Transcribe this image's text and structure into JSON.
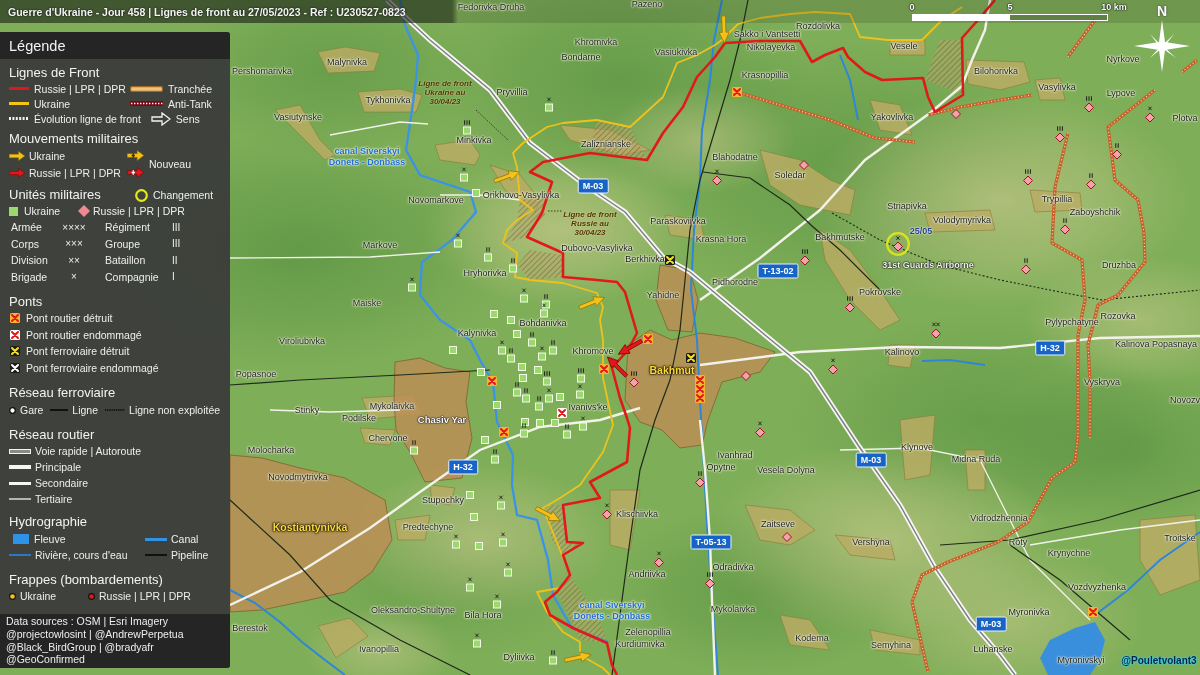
{
  "title": "Guerre d'Ukraine - Jour 458 | Lignes de front au 27/05/2023 - Ref : U230527-0823",
  "scale": {
    "labels": [
      "0",
      "5",
      "10 km"
    ]
  },
  "compass": {
    "label": "N"
  },
  "legend": {
    "title": "Légende",
    "front_lines": {
      "title": "Lignes de Front",
      "items": [
        {
          "kind": "russian_line",
          "label": "Russie | LPR | DPR"
        },
        {
          "kind": "trench",
          "label": "Tranchée"
        },
        {
          "kind": "ukrainian_line",
          "label": "Ukraine"
        },
        {
          "kind": "anti_tank",
          "label": "Anti-Tank"
        },
        {
          "kind": "evolution",
          "label": "Évolution ligne de front"
        },
        {
          "kind": "direction",
          "label": "Sens"
        }
      ]
    },
    "movements": {
      "title": "Mouvements militaires",
      "items": [
        {
          "kind": "ukraine",
          "label": "Ukraine"
        },
        {
          "kind": "russia",
          "label": "Russie | LPR | DPR"
        }
      ],
      "new_items": [
        {
          "kind": "ukraine"
        },
        {
          "kind": "russia"
        }
      ],
      "new_label": "Nouveau"
    },
    "units": {
      "title": "Unités militaires",
      "change_label": "Changement",
      "sides": [
        {
          "kind": "ukraine",
          "label": "Ukraine"
        },
        {
          "kind": "russia",
          "label": "Russie | LPR | DPR"
        }
      ],
      "echelons": [
        {
          "label": "Armée",
          "mark": "××××"
        },
        {
          "label": "Régiment",
          "mark": "III"
        },
        {
          "label": "Corps",
          "mark": "×××"
        },
        {
          "label": "Groupe",
          "mark": "III"
        },
        {
          "label": "Division",
          "mark": "××"
        },
        {
          "label": "Bataillon",
          "mark": "II"
        },
        {
          "label": "Brigade",
          "mark": "×"
        },
        {
          "label": "Compagnie",
          "mark": "I"
        }
      ]
    },
    "bridges": {
      "title": "Ponts",
      "items": [
        {
          "kind": "road_destroyed",
          "label": "Pont routier détruit"
        },
        {
          "kind": "road_damaged",
          "label": "Pont routier endommagé"
        },
        {
          "kind": "rail_destroyed",
          "label": "Pont ferroviaire détruit"
        },
        {
          "kind": "rail_damaged",
          "label": "Pont ferroviaire endommagé"
        }
      ]
    },
    "railway": {
      "title": "Réseau ferroviaire",
      "items": [
        {
          "kind": "station",
          "label": "Gare"
        },
        {
          "kind": "line",
          "label": "Ligne"
        },
        {
          "kind": "disused",
          "label": "Ligne non exploitée"
        }
      ]
    },
    "roads": {
      "title": "Réseau routier",
      "items": [
        {
          "kind": "highway",
          "label": "Voie rapide | Autoroute"
        },
        {
          "kind": "primary",
          "label": "Principale"
        },
        {
          "kind": "secondary",
          "label": "Secondaire"
        },
        {
          "kind": "tertiary",
          "label": "Tertiaire"
        }
      ]
    },
    "hydrography": {
      "title": "Hydrographie",
      "items": [
        {
          "kind": "fleuve",
          "label": "Fleuve"
        },
        {
          "kind": "canal",
          "label": "Canal"
        },
        {
          "kind": "river",
          "label": "Rivière, cours d'eau"
        },
        {
          "kind": "pipeline",
          "label": "Pipeline"
        }
      ]
    },
    "strikes": {
      "title": "Frappes (bombardements)",
      "items": [
        {
          "kind": "ukraine",
          "label": "Ukraine"
        },
        {
          "kind": "russia",
          "label": "Russie | LPR | DPR"
        }
      ]
    },
    "sources": [
      "Data sources : OSM | Esri Imagery",
      "@projectowlosint | @AndrewPerpetua",
      "@Black_BirdGroup | @bradyafr",
      "@GeoConfirmed"
    ]
  },
  "map": {
    "places": [
      {
        "kind": "village",
        "name": "Fedorivka Druha"
      },
      {
        "kind": "village",
        "name": "Pazeno"
      },
      {
        "kind": "village",
        "name": "Rozdolivka"
      },
      {
        "kind": "village",
        "name": "Sakko i Vantsetti"
      },
      {
        "kind": "village",
        "name": "Khromivka"
      },
      {
        "kind": "village",
        "name": "Nikolayevka"
      },
      {
        "kind": "village",
        "name": "Vesele"
      },
      {
        "kind": "village",
        "name": "Malynivka"
      },
      {
        "kind": "village",
        "name": "Bondarne"
      },
      {
        "kind": "village",
        "name": "Vasiukivka"
      },
      {
        "kind": "village",
        "name": "Nyrkove"
      },
      {
        "kind": "village",
        "name": "Pershomarivka"
      },
      {
        "kind": "village",
        "name": "Krasnopillia"
      },
      {
        "kind": "village",
        "name": "Bilohorivka"
      },
      {
        "kind": "village",
        "name": "Tykhonivka"
      },
      {
        "kind": "note",
        "lines": [
          "Ligne de front",
          "Ukraine au",
          "30/04/23"
        ]
      },
      {
        "kind": "village",
        "name": "Pryvillia"
      },
      {
        "kind": "village",
        "name": "Vasylivka"
      },
      {
        "kind": "village",
        "name": "Lypove"
      },
      {
        "kind": "village",
        "name": "Vasiutynske"
      },
      {
        "kind": "village",
        "name": "Yakovlivka"
      },
      {
        "kind": "village",
        "name": "Plotva"
      },
      {
        "kind": "village",
        "name": "Minkivka"
      },
      {
        "kind": "village",
        "name": "Zaliznianske"
      },
      {
        "kind": "canal",
        "lines": [
          "canal Siverskyi",
          "Donets - Donbass"
        ]
      },
      {
        "kind": "village",
        "name": "Blahodatne"
      },
      {
        "kind": "village",
        "name": "Soledar"
      },
      {
        "kind": "village",
        "name": "Novomarkove"
      },
      {
        "kind": "village",
        "name": "Orikhovo-Vasylivka"
      },
      {
        "kind": "village",
        "name": "Striapivka"
      },
      {
        "kind": "village",
        "name": "Trypillia"
      },
      {
        "kind": "note",
        "lines": [
          "Ligne de front",
          "Russie au",
          "30/04/23"
        ]
      },
      {
        "kind": "village",
        "name": "Zaboyshchik"
      },
      {
        "kind": "village",
        "name": "Paraskoviivka"
      },
      {
        "kind": "village",
        "name": "Volodymyrivka"
      },
      {
        "kind": "village",
        "name": "Krasna Hora"
      },
      {
        "kind": "village",
        "name": "Bakhmutske"
      },
      {
        "kind": "village",
        "name": "Markove"
      },
      {
        "kind": "village",
        "name": "Dubovo-Vasylivka"
      },
      {
        "kind": "village",
        "name": "Berkhivka"
      },
      {
        "kind": "village",
        "name": "Druzhba"
      },
      {
        "kind": "village",
        "name": "Hryhorivka"
      },
      {
        "kind": "village",
        "name": "Pidhorodne"
      },
      {
        "kind": "village",
        "name": "Yahidne"
      },
      {
        "kind": "village",
        "name": "Pokrovske"
      },
      {
        "kind": "village",
        "name": "Maiske"
      },
      {
        "kind": "village",
        "name": "Pylypchatyne"
      },
      {
        "kind": "village",
        "name": "Rozovka"
      },
      {
        "kind": "village",
        "name": "Bohdanivka"
      },
      {
        "kind": "village",
        "name": "Kalynivka"
      },
      {
        "kind": "village",
        "name": "Viroliubivka"
      },
      {
        "kind": "village",
        "name": "Kalinova Popasnaya"
      },
      {
        "kind": "village",
        "name": "Khromove"
      },
      {
        "kind": "village",
        "name": "Kalinovo"
      },
      {
        "kind": "village",
        "name": "Popasnoe"
      },
      {
        "kind": "city",
        "name": "Bakhmut"
      },
      {
        "kind": "village",
        "name": "Vyskryva"
      },
      {
        "kind": "village",
        "name": "Stinky"
      },
      {
        "kind": "village",
        "name": "Mykolaivka"
      },
      {
        "kind": "village",
        "name": "Ivanivs'ke"
      },
      {
        "kind": "village",
        "name": "Novozv"
      },
      {
        "kind": "village",
        "name": "Podilske"
      },
      {
        "kind": "town",
        "name": "Chasiv Yar"
      },
      {
        "kind": "village",
        "name": "Chervone"
      },
      {
        "kind": "village",
        "name": "Molocharka"
      },
      {
        "kind": "village",
        "name": "Klynove"
      },
      {
        "kind": "village",
        "name": "Ivanhrad"
      },
      {
        "kind": "village",
        "name": "Midna Ruda"
      },
      {
        "kind": "village",
        "name": "Opytne"
      },
      {
        "kind": "village",
        "name": "Vesela Dolyna"
      },
      {
        "kind": "village",
        "name": "Novodmytrivka"
      },
      {
        "kind": "village",
        "name": "Stupochky"
      },
      {
        "kind": "city",
        "name": "Kostiantynivka"
      },
      {
        "kind": "village",
        "name": "Predtechyne"
      },
      {
        "kind": "village",
        "name": "Klischiivka"
      },
      {
        "kind": "village",
        "name": "Zaitseve"
      },
      {
        "kind": "village",
        "name": "Vidrodzhennia"
      },
      {
        "kind": "village",
        "name": "Vershyna"
      },
      {
        "kind": "village",
        "name": "Roty"
      },
      {
        "kind": "village",
        "name": "Troitske"
      },
      {
        "kind": "village",
        "name": "Krynychne"
      },
      {
        "kind": "village",
        "name": "Odradivka"
      },
      {
        "kind": "village",
        "name": "Andriivka"
      },
      {
        "kind": "village",
        "name": "Vozdvyzhenka"
      },
      {
        "kind": "village",
        "name": "Oleksandro-Shultyne"
      },
      {
        "kind": "village",
        "name": "Bila Hora"
      },
      {
        "kind": "canal",
        "lines": [
          "canal Siverskyi",
          "Donets - Donbass"
        ]
      },
      {
        "kind": "village",
        "name": "Mykolaivka"
      },
      {
        "kind": "village",
        "name": "Myronivka"
      },
      {
        "kind": "village",
        "name": "Berestok"
      },
      {
        "kind": "village",
        "name": "Zelenopillia"
      },
      {
        "kind": "village",
        "name": "Ivanopillia"
      },
      {
        "kind": "village",
        "name": "Kurdiumivka"
      },
      {
        "kind": "village",
        "name": "Kodema"
      },
      {
        "kind": "village",
        "name": "Semyhina"
      },
      {
        "kind": "village",
        "name": "Luhanske"
      },
      {
        "kind": "village",
        "name": "Dyliivka"
      },
      {
        "kind": "village",
        "name": "Myronivskyi"
      }
    ],
    "road_shields": [
      "M-03",
      "T-13-02",
      "H-32",
      "M-03",
      "H-32",
      "T-05-13",
      "M-03"
    ],
    "units": [
      {
        "kind": "ukraine_brigade",
        "changed": false
      },
      {
        "kind": "russia_regiment",
        "changed": false
      },
      {
        "kind": "russia_unit",
        "changed": false
      },
      {
        "kind": "russia_brigade",
        "changed": false
      },
      {
        "kind": "ukraine_regiment",
        "changed": false
      },
      {
        "kind": "russia_regiment",
        "changed": false
      },
      {
        "kind": "russia_battalion",
        "changed": false
      },
      {
        "kind": "russia_unit",
        "changed": false
      },
      {
        "kind": "ukraine_brigade",
        "changed": false
      },
      {
        "kind": "russia_brigade",
        "changed": false
      },
      {
        "kind": "russia_regiment",
        "changed": false
      },
      {
        "kind": "russia_battalion",
        "changed": false
      },
      {
        "kind": "ukraine_unit",
        "changed": false
      },
      {
        "kind": "russia_battalion",
        "changed": false
      },
      {
        "kind": "ukraine_brigade",
        "changed": false
      },
      {
        "kind": "russia_brigade",
        "changed": true,
        "label": "31st Guards Airborne",
        "date": "25/05"
      },
      {
        "kind": "ukraine_battalion",
        "changed": false
      },
      {
        "kind": "russia_regiment",
        "changed": false
      },
      {
        "kind": "ukraine_battalion",
        "changed": false
      },
      {
        "kind": "russia_battalion",
        "changed": false
      },
      {
        "kind": "ukraine_brigade",
        "changed": false
      },
      {
        "kind": "ukraine_brigade",
        "changed": false
      },
      {
        "kind": "ukraine_battalion",
        "changed": false
      },
      {
        "kind": "russia_regiment",
        "changed": false
      },
      {
        "kind": "ukraine_unit",
        "changed": false
      },
      {
        "kind": "ukraine_brigade",
        "changed": false
      },
      {
        "kind": "ukraine_unit",
        "changed": false
      },
      {
        "kind": "ukraine_unit",
        "changed": false
      },
      {
        "kind": "russia_division",
        "changed": false
      },
      {
        "kind": "ukraine_battalion",
        "changed": false
      },
      {
        "kind": "ukraine_unit",
        "changed": false
      },
      {
        "kind": "ukraine_brigade",
        "changed": false
      },
      {
        "kind": "ukraine_battalion",
        "changed": false
      },
      {
        "kind": "ukraine_battalion",
        "changed": false
      },
      {
        "kind": "ukraine_brigade",
        "changed": false
      },
      {
        "kind": "ukraine_unit",
        "changed": false
      },
      {
        "kind": "ukraine_unit",
        "changed": false
      },
      {
        "kind": "ukraine_unit",
        "changed": false
      },
      {
        "kind": "ukraine_unit",
        "changed": false
      },
      {
        "kind": "ukraine_regiment",
        "changed": false
      },
      {
        "kind": "ukraine_regiment",
        "changed": false
      },
      {
        "kind": "russia_regiment",
        "changed": false
      },
      {
        "kind": "russia_unit",
        "changed": false
      },
      {
        "kind": "russia_brigade",
        "changed": false
      },
      {
        "kind": "ukraine_battalion",
        "changed": false
      },
      {
        "kind": "ukraine_battalion",
        "changed": false
      },
      {
        "kind": "ukraine_brigade",
        "changed": false
      },
      {
        "kind": "ukraine_unit",
        "changed": false
      },
      {
        "kind": "ukraine_brigade",
        "changed": false
      },
      {
        "kind": "ukraine_unit",
        "changed": false
      },
      {
        "kind": "ukraine_battalion",
        "changed": false
      },
      {
        "kind": "ukraine_unit",
        "changed": false
      },
      {
        "kind": "ukraine_unit",
        "changed": false
      },
      {
        "kind": "ukraine_unit",
        "changed": false
      },
      {
        "kind": "ukraine_brigade",
        "changed": false
      },
      {
        "kind": "ukraine_battalion",
        "changed": false
      },
      {
        "kind": "ukraine_battalion",
        "changed": false
      },
      {
        "kind": "russia_brigade",
        "changed": false
      },
      {
        "kind": "ukraine_unit",
        "changed": false
      },
      {
        "kind": "ukraine_battalion",
        "changed": false
      },
      {
        "kind": "ukraine_battalion",
        "changed": false
      },
      {
        "kind": "russia_battalion",
        "changed": false
      },
      {
        "kind": "ukraine_unit",
        "changed": false
      },
      {
        "kind": "ukraine_brigade",
        "changed": false
      },
      {
        "kind": "ukraine_unit",
        "changed": false
      },
      {
        "kind": "russia_brigade",
        "changed": false
      },
      {
        "kind": "ukraine_brigade",
        "changed": false
      },
      {
        "kind": "ukraine_unit",
        "changed": false
      },
      {
        "kind": "ukraine_brigade",
        "changed": false
      },
      {
        "kind": "russia_unit",
        "changed": false
      },
      {
        "kind": "russia_brigade",
        "changed": false
      },
      {
        "kind": "ukraine_brigade",
        "changed": false
      },
      {
        "kind": "ukraine_brigade",
        "changed": false
      },
      {
        "kind": "russia_regiment",
        "changed": false
      },
      {
        "kind": "ukraine_brigade",
        "changed": false
      },
      {
        "kind": "ukraine_brigade",
        "changed": false
      },
      {
        "kind": "ukraine_battalion",
        "changed": false
      }
    ],
    "bridges": [
      {
        "kind": "road_destroyed"
      },
      {
        "kind": "rail_destroyed"
      },
      {
        "kind": "road_destroyed"
      },
      {
        "kind": "rail_destroyed"
      },
      {
        "kind": "road_destroyed"
      },
      {
        "kind": "road_destroyed"
      },
      {
        "kind": "road_destroyed"
      },
      {
        "kind": "road_destroyed"
      },
      {
        "kind": "road_destroyed"
      },
      {
        "kind": "road_damaged"
      },
      {
        "kind": "road_destroyed"
      },
      {
        "kind": "road_destroyed"
      }
    ],
    "movements": [
      {
        "kind": "ukraine"
      },
      {
        "kind": "ukraine"
      },
      {
        "kind": "ukraine"
      },
      {
        "kind": "russia"
      },
      {
        "kind": "russia"
      },
      {
        "kind": "ukraine"
      },
      {
        "kind": "ukraine"
      }
    ]
  },
  "credit": "@Pouletvolant3"
}
